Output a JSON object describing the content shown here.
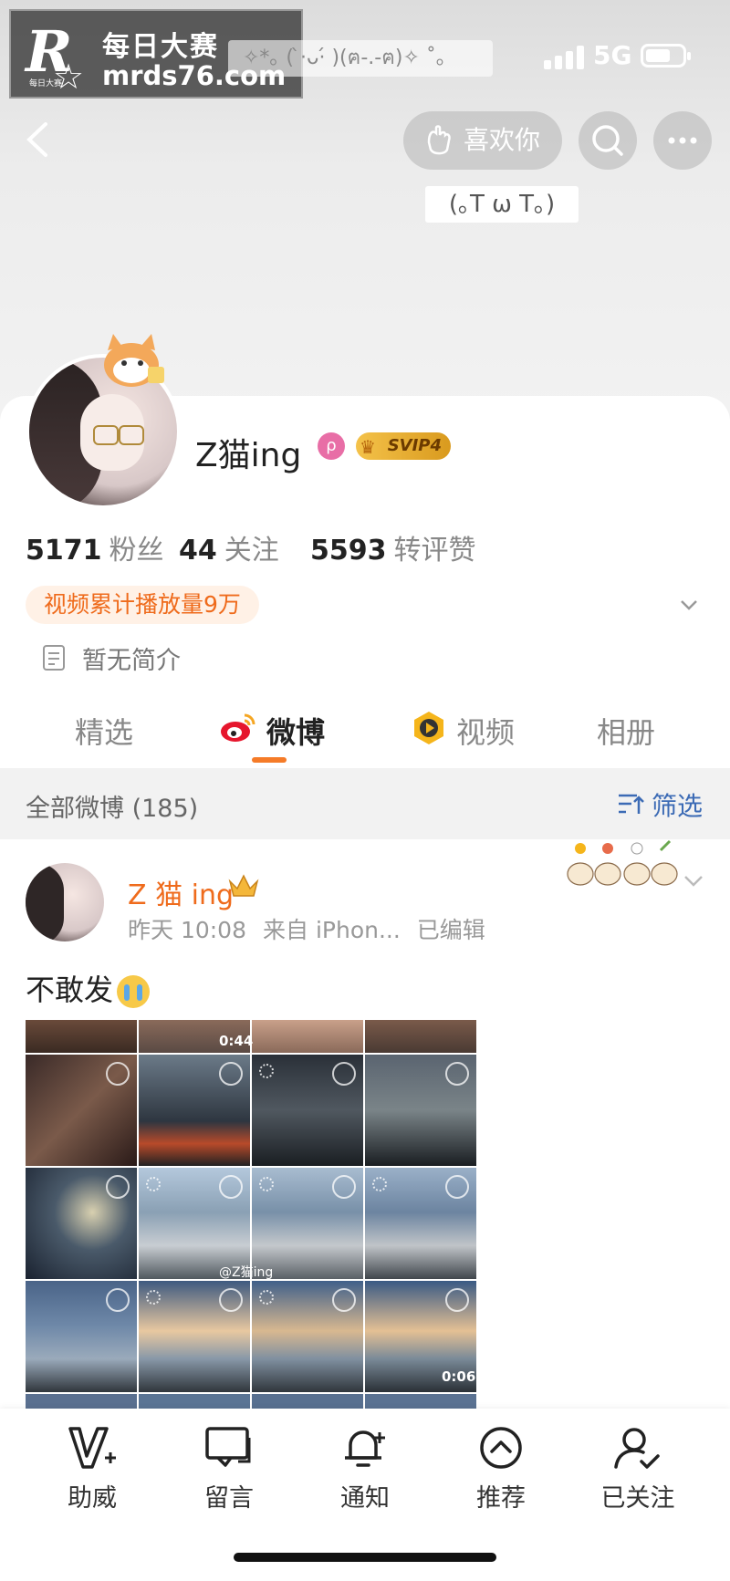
{
  "status_bar": {
    "kaomoji_banner": "✧*｡ ( ̀·ᴗ·́ )(ฅ-.-ฅ)✧ ˚｡",
    "network": "5G"
  },
  "watermark": {
    "logo_letter": "R",
    "line1": "每日大赛",
    "line2": "mrds76.com",
    "small": "每日大赛"
  },
  "header": {
    "like_button_label": "喜欢你",
    "kaomoji_tag": "(｡T ω T｡)"
  },
  "profile": {
    "username": "Z猫ing",
    "badge_glyph": "ρ",
    "vip_label": "SVIP4",
    "stats": [
      {
        "num": "5171",
        "label": "粉丝"
      },
      {
        "num": "44",
        "label": "关注"
      },
      {
        "num": "5593",
        "label": "转评赞"
      }
    ],
    "video_stat_pill": "视频累计播放量9万",
    "intro": "暂无简介"
  },
  "tabs": [
    {
      "label": "精选",
      "active": false
    },
    {
      "label": "微博",
      "active": true
    },
    {
      "label": "视频",
      "active": false
    },
    {
      "label": "相册",
      "active": false
    }
  ],
  "filter_bar": {
    "title": "全部微博 (185)",
    "filter_label": "筛选"
  },
  "post": {
    "author": "Z 猫 ing",
    "time": "昨天 10:08",
    "source": "来自 iPhon...",
    "edited": "已编辑",
    "text": "不敢发",
    "grid_watermark": "@Z猫ing",
    "durations": [
      "0:44",
      "0:06"
    ]
  },
  "bottom_bar": [
    {
      "label": "助威",
      "icon": "support-v-icon"
    },
    {
      "label": "留言",
      "icon": "message-icon"
    },
    {
      "label": "通知",
      "icon": "bell-plus-icon"
    },
    {
      "label": "推荐",
      "icon": "chevron-up-circle-icon"
    },
    {
      "label": "已关注",
      "icon": "user-check-icon"
    }
  ],
  "colors": {
    "accent_orange": "#ef6b1c",
    "link_blue": "#3c6bb5",
    "vip_gold": "#f4c24a"
  }
}
